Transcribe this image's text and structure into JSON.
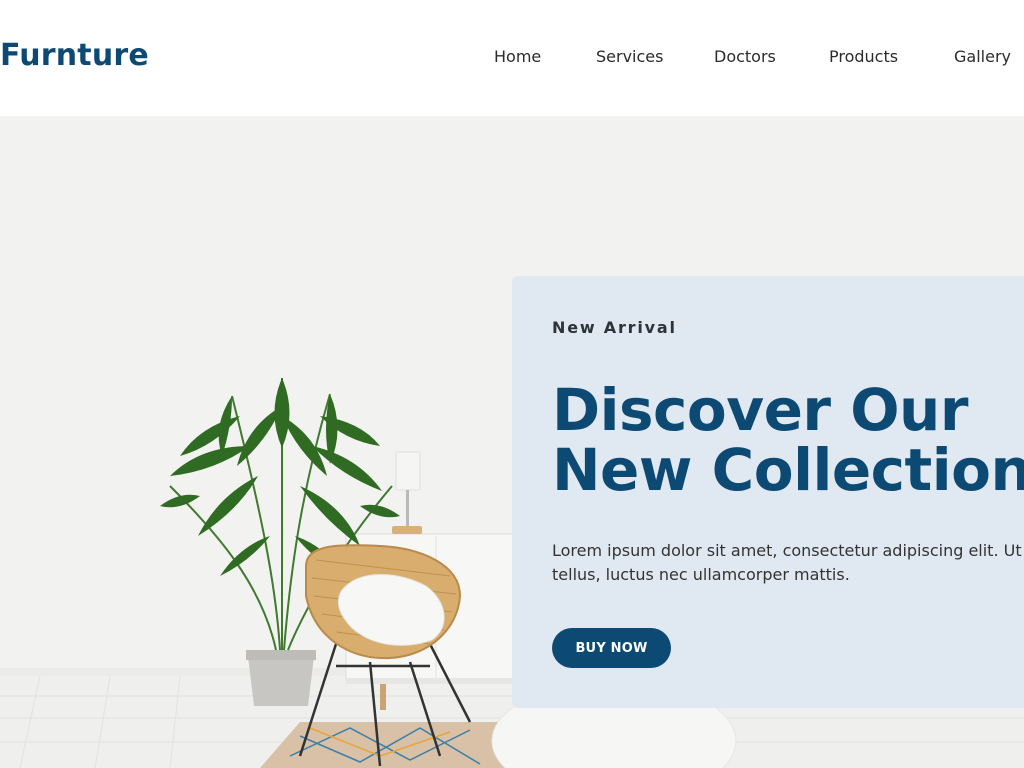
{
  "header": {
    "logo": "Furnture",
    "nav": [
      {
        "label": "Home"
      },
      {
        "label": "Services"
      },
      {
        "label": "Doctors"
      },
      {
        "label": "Products"
      },
      {
        "label": "Gallery"
      }
    ]
  },
  "hero": {
    "eyebrow": "New Arrival",
    "headline_line1": "Discover Our",
    "headline_line2": "New Collection",
    "description": "Lorem ipsum dolor sit amet, consectetur adipiscing elit. Ut elit tellus, luctus nec ullamcorper mattis.",
    "cta_label": "BUY NOW"
  },
  "colors": {
    "brand": "#0d4a73",
    "card_bg": "#e0e8f2",
    "text": "#2b2b2b"
  }
}
